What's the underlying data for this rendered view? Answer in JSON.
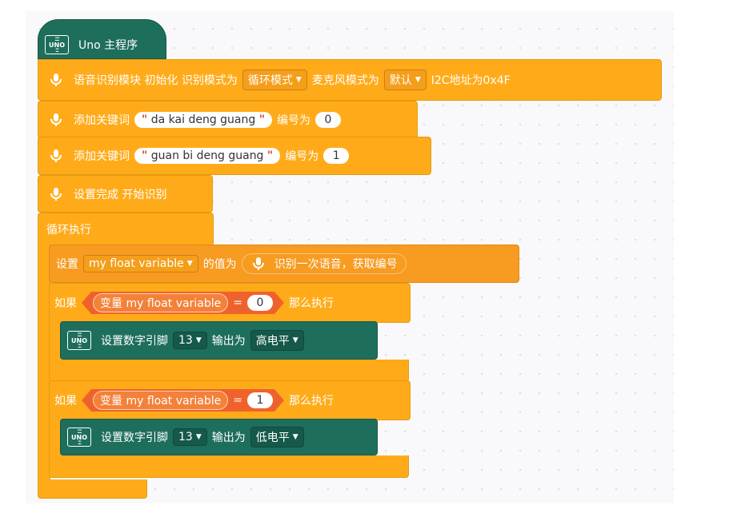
{
  "hat": {
    "icon": "uno-board-icon",
    "title": "Uno 主程序"
  },
  "voice_init": {
    "label": "语音识别模块 初始化 识别模式为",
    "mode_value": "循环模式",
    "mic_label": "麦克风模式为",
    "mic_value": "默认",
    "i2c_label": "I2C地址为0x4F"
  },
  "keywords": [
    {
      "label": "添加关键词",
      "keyword": "da kai deng guang",
      "number_label": "编号为",
      "number": "0"
    },
    {
      "label": "添加关键词",
      "keyword": "guan bi deng guang",
      "number_label": "编号为",
      "number": "1"
    }
  ],
  "start": {
    "label": "设置完成 开始识别"
  },
  "loop": {
    "label": "循环执行"
  },
  "set_var": {
    "label": "设置",
    "variable": "my float variable",
    "value_label": "的值为",
    "reporter_label": "识别一次语音，获取编号"
  },
  "if_blocks": [
    {
      "if_label": "如果",
      "var_label": "变量 my float variable",
      "op": "=",
      "value": "0",
      "then_label": "那么执行",
      "action": {
        "label": "设置数字引脚",
        "pin": "13",
        "output_label": "输出为",
        "level": "高电平"
      }
    },
    {
      "if_label": "如果",
      "var_label": "变量 my float variable",
      "op": "=",
      "value": "1",
      "then_label": "那么执行",
      "action": {
        "label": "设置数字引脚",
        "pin": "13",
        "output_label": "输出为",
        "level": "低电平"
      }
    }
  ],
  "colors": {
    "voice": "#ffab19",
    "control": "#ffab19",
    "variable": "#f79b21",
    "uno": "#1e6e5c",
    "operator": "#f0622b"
  }
}
